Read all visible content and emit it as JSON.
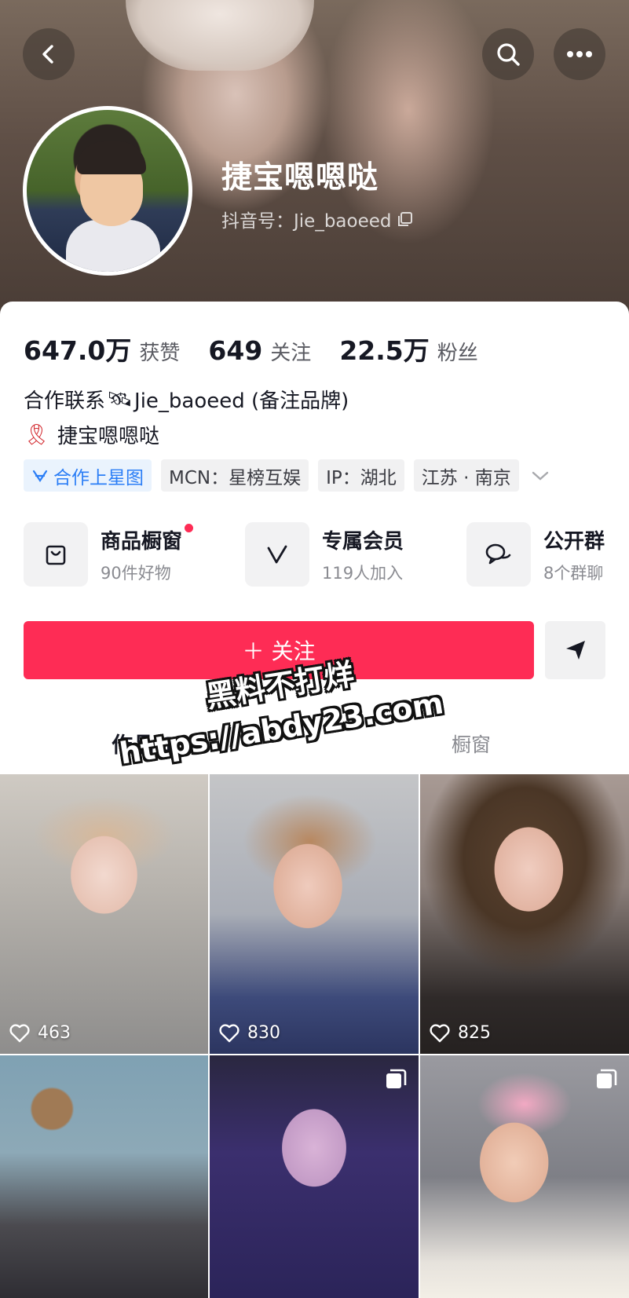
{
  "profile": {
    "nickname": "捷宝嗯嗯哒",
    "douyin_id": "抖音号：Jie_baoeed"
  },
  "stats": [
    {
      "value": "647.0万",
      "label": "获赞"
    },
    {
      "value": "649",
      "label": "关注"
    },
    {
      "value": "22.5万",
      "label": "粉丝"
    }
  ],
  "bio": {
    "line1_prefix": "合作联系",
    "line1_emoji": "🛰",
    "line1_text": "Jie_baoeed (备注品牌)",
    "line2_emoji": "🎗",
    "line2_text": "捷宝嗯嗯哒"
  },
  "tags": {
    "star_map": "合作上星图",
    "mcn": "MCN：星榜互娱",
    "ip": "IP：湖北",
    "location": "江苏 · 南京"
  },
  "services": [
    {
      "title": "商品橱窗",
      "sub": "90件好物",
      "icon": "bag-icon",
      "dot": true
    },
    {
      "title": "专属会员",
      "sub": "119人加入",
      "icon": "v-badge-icon",
      "dot": false
    },
    {
      "title": "公开群",
      "sub": "8个群聊",
      "icon": "chat-bubbles-icon",
      "dot": false
    }
  ],
  "actions": {
    "follow": "＋ 关注"
  },
  "tabs": {
    "works": "作品 115",
    "showcase": "橱窗"
  },
  "watermark": {
    "line1": "黑料不打烊",
    "line2": "https://abdy23.com"
  },
  "videos": [
    {
      "likes": "463"
    },
    {
      "likes": "830"
    },
    {
      "likes": "825"
    },
    {
      "likes": ""
    },
    {
      "likes": ""
    },
    {
      "likes": ""
    }
  ],
  "colors": {
    "accent": "#fe2c55",
    "star_blue": "#2b7ef6"
  }
}
